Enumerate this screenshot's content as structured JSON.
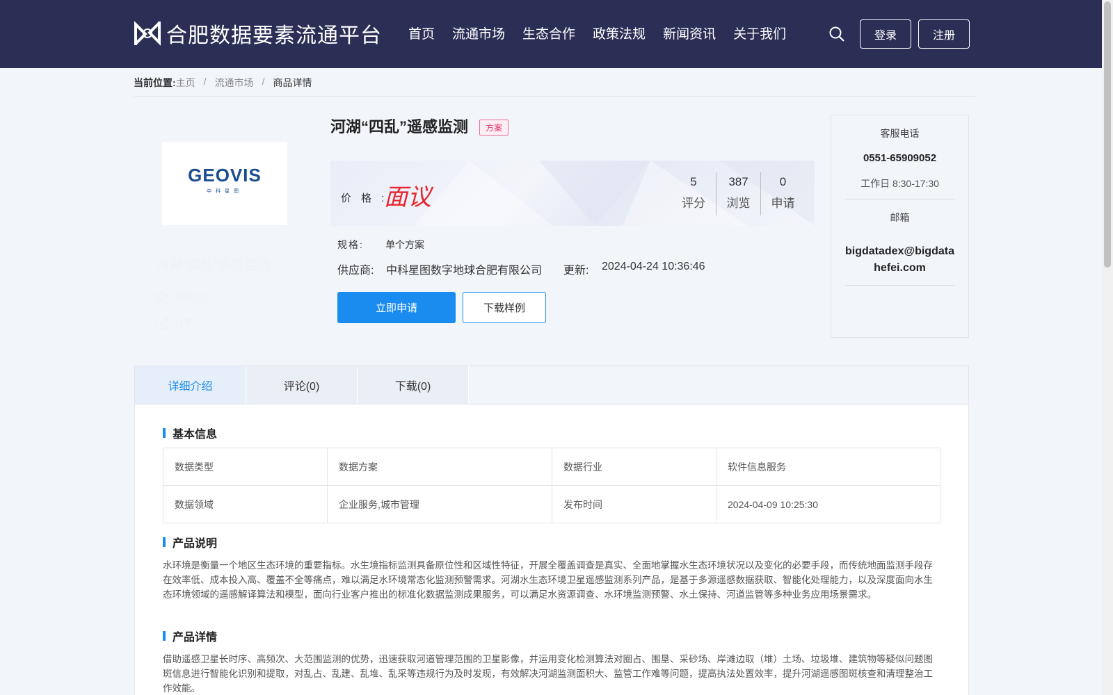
{
  "header": {
    "logo_title": "合肥数据要素流通平台",
    "nav": [
      "首页",
      "流通市场",
      "生态合作",
      "政策法规",
      "新闻资讯",
      "关于我们"
    ],
    "login_label": "登录",
    "register_label": "注册",
    "bg_color": "#2b2e55"
  },
  "breadcrumb": {
    "label": "当前位置:",
    "items": [
      "主页",
      "流通市场",
      "商品详情"
    ]
  },
  "product": {
    "logo_text": "GEOVIS",
    "logo_subtext": "中科星图",
    "ghost_title": "河湖“四乱”遥感监测",
    "favorite_label": "收藏(0)",
    "share_label": "分享",
    "title": "河湖“四乱”遥感监测",
    "tag": "方案",
    "price_label": "价格:",
    "price_value": "面议",
    "stats": [
      {
        "value": "5",
        "label": "评分"
      },
      {
        "value": "387",
        "label": "浏览"
      },
      {
        "value": "0",
        "label": "申请"
      }
    ],
    "spec_label": "规格:",
    "spec_value": "单个方案",
    "supplier_label": "供应商:",
    "supplier_value": "中科星图数字地球合肥有限公司",
    "updated_label": "更新:",
    "updated_value": "2024-04-24 10:36:46",
    "apply_label": "立即申请",
    "download_label": "下载样例"
  },
  "contact": {
    "phone_label": "客服电话",
    "phone": "0551-65909052",
    "hours": "工作日 8:30-17:30",
    "email_label": "邮箱",
    "email": "bigdatadex@bigdatahefei.com"
  },
  "tabs": [
    "详细介绍",
    "评论(0)",
    "下载(0)"
  ],
  "details": {
    "basic_title": "基本信息",
    "table": [
      [
        "数据类型",
        "数据方案",
        "数据行业",
        "软件信息服务"
      ],
      [
        "数据领域",
        "企业服务,城市管理",
        "发布时间",
        "2024-04-09 10:25:30"
      ]
    ],
    "desc_title": "产品说明",
    "desc_text": "水环境是衡量一个地区生态环境的重要指标。水生境指标监测具备原位性和区域性特征，开展全覆盖调查是真实、全面地掌握水生态环境状况以及变化的必要手段，而传统地面监测手段存在效率低、成本投入高、覆盖不全等痛点，难以满足水环境常态化监测预警需求。河湖水生态环境卫星遥感监测系列产品，是基于多源遥感数据获取、智能化处理能力，以及深度面向水生态环境领域的遥感解译算法和模型，面向行业客户推出的标准化数据监测成果服务，可以满足水资源调查、水环境监测预警、水土保持、河道监管等多种业务应用场景需求。",
    "detail_title": "产品详情",
    "detail_text": "借助遥感卫星长时序、高频次、大范围监测的优势，迅速获取河道管理范围的卫星影像，并运用变化检测算法对圈占、围垦、采砂场、岸滩边取（堆）土场、垃圾堆、建筑物等疑似问题图斑信息进行智能化识别和提取，对乱占、乱建、乱堆、乱采等违规行为及时发现，有效解决河湖监测面积大、监管工作难等问题，提高执法处置效率，提升河湖遥感图斑核查和清理整治工作效能。"
  }
}
